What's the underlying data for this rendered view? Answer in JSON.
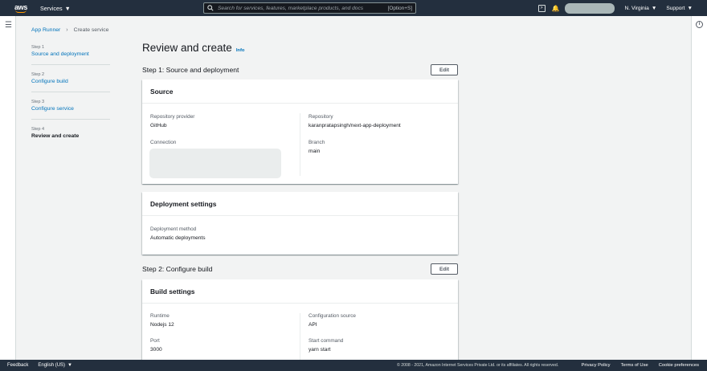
{
  "topnav": {
    "logo_text": "aws",
    "services_label": "Services",
    "search_placeholder": "Search for services, features, marketplace products, and docs",
    "search_shortcut": "[Option+S]",
    "region_label": "N. Virginia",
    "support_label": "Support"
  },
  "breadcrumb": {
    "items": [
      "App Runner",
      "Create service"
    ]
  },
  "wizard": {
    "steps": [
      {
        "num": "Step 1",
        "label": "Source and deployment"
      },
      {
        "num": "Step 2",
        "label": "Configure build"
      },
      {
        "num": "Step 3",
        "label": "Configure service"
      },
      {
        "num": "Step 4",
        "label": "Review and create"
      }
    ]
  },
  "page": {
    "title": "Review and create",
    "info_link": "Info"
  },
  "step1": {
    "title": "Step 1: Source and deployment",
    "edit_label": "Edit",
    "source_card": {
      "title": "Source",
      "repo_provider_label": "Repository provider",
      "repo_provider_value": "GitHub",
      "connection_label": "Connection",
      "repository_label": "Repository",
      "repository_value": "karanpratapsingh/next-app-deployment",
      "branch_label": "Branch",
      "branch_value": "main"
    },
    "deployment_card": {
      "title": "Deployment settings",
      "method_label": "Deployment method",
      "method_value": "Automatic deployments"
    }
  },
  "step2": {
    "title": "Step 2: Configure build",
    "edit_label": "Edit",
    "build_card": {
      "title": "Build settings",
      "runtime_label": "Runtime",
      "runtime_value": "Nodejs 12",
      "port_label": "Port",
      "port_value": "3000",
      "config_source_label": "Configuration source",
      "config_source_value": "API",
      "start_command_label": "Start command",
      "start_command_value": "yarn start"
    }
  },
  "footer": {
    "feedback": "Feedback",
    "language": "English (US)",
    "copyright": "© 2008 - 2021, Amazon Internet Services Private Ltd. or its affiliates. All rights reserved.",
    "links": [
      "Privacy Policy",
      "Terms of Use",
      "Cookie preferences"
    ]
  },
  "colors": {
    "nav_bg": "#232f3e",
    "link": "#0073bb",
    "accent": "#ff9900"
  }
}
